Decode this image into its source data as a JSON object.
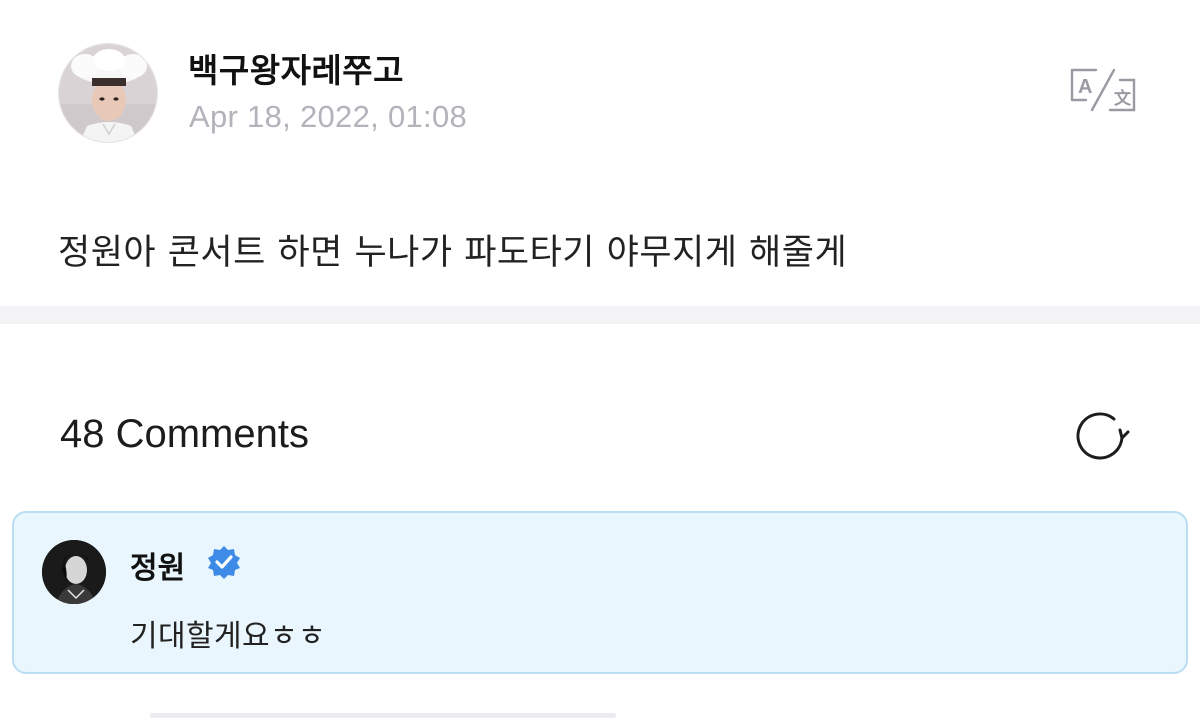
{
  "post": {
    "author_name": "백구왕자레쭈고",
    "timestamp": "Apr 18, 2022, 01:08",
    "body": "정원아 콘서트 하면 누나가 파도타기 야무지게 해줄게",
    "translate_icon": "translate-icon"
  },
  "comments": {
    "count_label": "48 Comments",
    "refresh_icon": "refresh-icon",
    "highlighted": {
      "author_name": "정원",
      "verified": true,
      "text": "기대할게요ㅎㅎ"
    }
  },
  "colors": {
    "accent_verified": "#3d8be6",
    "highlight_bg": "#eaf6fd",
    "highlight_border": "#b9def2",
    "muted_text": "#b3b3bb"
  }
}
